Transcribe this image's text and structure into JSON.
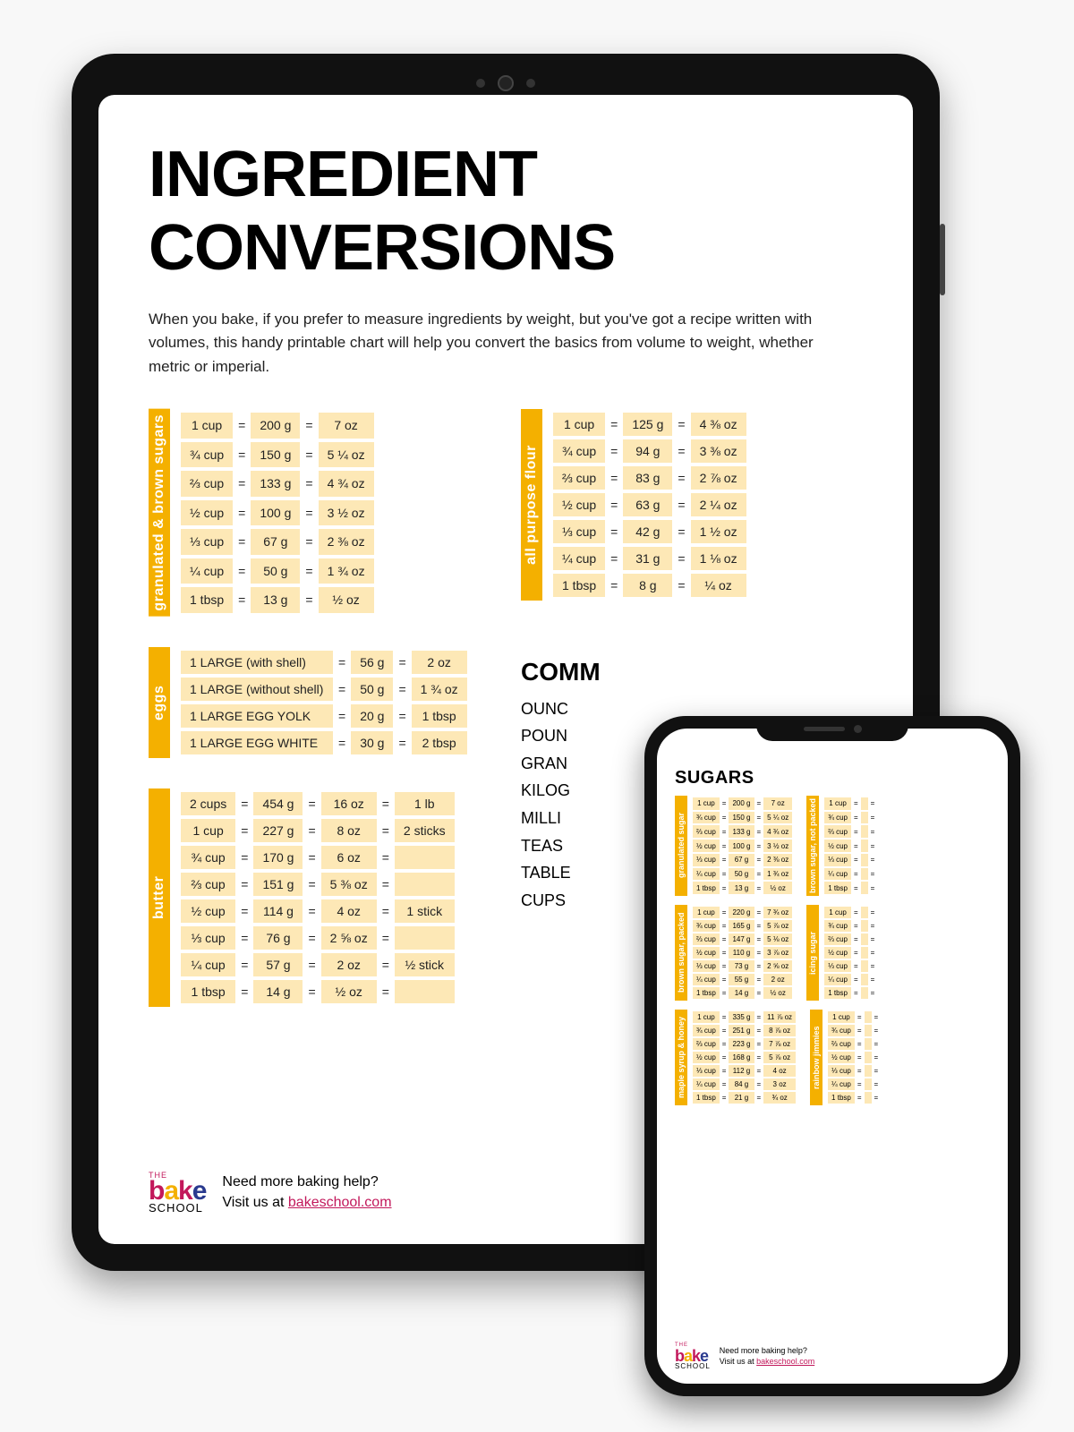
{
  "tablet": {
    "title": "INGREDIENT CONVERSIONS",
    "intro": "When you bake, if you prefer to measure ingredients by weight, but you've got a recipe written with volumes, this handy printable chart will help you convert the basics from volume to weight, whether metric or imperial.",
    "charts": {
      "sugars": {
        "label": "granulated & brown sugars",
        "rows": [
          [
            "1 cup",
            "200 g",
            "7 oz"
          ],
          [
            "¾ cup",
            "150 g",
            "5 ¼ oz"
          ],
          [
            "⅔ cup",
            "133 g",
            "4 ¾ oz"
          ],
          [
            "½ cup",
            "100 g",
            "3 ½ oz"
          ],
          [
            "⅓ cup",
            "67 g",
            "2 ⅜ oz"
          ],
          [
            "¼ cup",
            "50 g",
            "1 ¾ oz"
          ],
          [
            "1 tbsp",
            "13 g",
            "½ oz"
          ]
        ]
      },
      "flour": {
        "label": "all purpose flour",
        "rows": [
          [
            "1 cup",
            "125 g",
            "4 ⅜ oz"
          ],
          [
            "¾ cup",
            "94 g",
            "3 ⅜ oz"
          ],
          [
            "⅔ cup",
            "83 g",
            "2 ⅞ oz"
          ],
          [
            "½ cup",
            "63 g",
            "2 ¼ oz"
          ],
          [
            "⅓ cup",
            "42 g",
            "1 ½ oz"
          ],
          [
            "¼ cup",
            "31 g",
            "1 ⅛ oz"
          ],
          [
            "1 tbsp",
            "8 g",
            "¼ oz"
          ]
        ]
      },
      "eggs": {
        "label": "eggs",
        "rows": [
          [
            "1 LARGE (with shell)",
            "56 g",
            "2 oz"
          ],
          [
            "1 LARGE (without shell)",
            "50 g",
            "1 ¾ oz"
          ],
          [
            "1 LARGE EGG YOLK",
            "20 g",
            "1 tbsp"
          ],
          [
            "1 LARGE EGG WHITE",
            "30 g",
            "2 tbsp"
          ]
        ]
      },
      "butter": {
        "label": "butter",
        "rows": [
          [
            "2 cups",
            "454 g",
            "16 oz",
            "1 lb"
          ],
          [
            "1 cup",
            "227 g",
            "8 oz",
            "2 sticks"
          ],
          [
            "¾ cup",
            "170 g",
            "6 oz",
            ""
          ],
          [
            "⅔ cup",
            "151 g",
            "5 ⅜ oz",
            ""
          ],
          [
            "½ cup",
            "114 g",
            "4 oz",
            "1 stick"
          ],
          [
            "⅓ cup",
            "76 g",
            "2 ⅝ oz",
            ""
          ],
          [
            "¼ cup",
            "57 g",
            "2 oz",
            "½ stick"
          ],
          [
            "1 tbsp",
            "14 g",
            "½ oz",
            ""
          ]
        ]
      }
    },
    "abbrev": {
      "heading": "COMM",
      "lines": [
        "OUNC",
        "POUN",
        "GRAN",
        "KILOG",
        "MILLI",
        "TEAS",
        "TABLE",
        "CUPS"
      ]
    },
    "footer": {
      "help": "Need more baking help?",
      "visit": "Visit us at ",
      "link": "bakeschool.com"
    },
    "logo": {
      "the": "THE",
      "b": "b",
      "a": "a",
      "k": "k",
      "e": "e",
      "school": "SCHOOL"
    }
  },
  "phone": {
    "heading": "SUGARS",
    "charts": [
      {
        "label": "granulated sugar",
        "rows": [
          [
            "1 cup",
            "200 g",
            "7 oz"
          ],
          [
            "¾ cup",
            "150 g",
            "5 ¼ oz"
          ],
          [
            "⅔ cup",
            "133 g",
            "4 ¾ oz"
          ],
          [
            "½ cup",
            "100 g",
            "3 ½ oz"
          ],
          [
            "⅓ cup",
            "67 g",
            "2 ⅜ oz"
          ],
          [
            "¼ cup",
            "50 g",
            "1 ¾ oz"
          ],
          [
            "1 tbsp",
            "13 g",
            "½ oz"
          ]
        ]
      },
      {
        "label": "brown sugar, not packed",
        "rows": [
          [
            "1 cup",
            ""
          ],
          [
            "¾ cup",
            ""
          ],
          [
            "⅔ cup",
            ""
          ],
          [
            "½ cup",
            ""
          ],
          [
            "⅓ cup",
            ""
          ],
          [
            "¼ cup",
            ""
          ],
          [
            "1 tbsp",
            ""
          ]
        ]
      },
      {
        "label": "brown sugar, packed",
        "rows": [
          [
            "1 cup",
            "220 g",
            "7 ¾ oz"
          ],
          [
            "¾ cup",
            "165 g",
            "5 ⅞ oz"
          ],
          [
            "⅔ cup",
            "147 g",
            "5 ⅛ oz"
          ],
          [
            "½ cup",
            "110 g",
            "3 ⅞ oz"
          ],
          [
            "⅓ cup",
            "73 g",
            "2 ⅝ oz"
          ],
          [
            "¼ cup",
            "55 g",
            "2 oz"
          ],
          [
            "1 tbsp",
            "14 g",
            "½ oz"
          ]
        ]
      },
      {
        "label": "icing sugar",
        "rows": [
          [
            "1 cup",
            ""
          ],
          [
            "¾ cup",
            ""
          ],
          [
            "⅔ cup",
            ""
          ],
          [
            "½ cup",
            ""
          ],
          [
            "⅓ cup",
            ""
          ],
          [
            "¼ cup",
            ""
          ],
          [
            "1 tbsp",
            ""
          ]
        ]
      },
      {
        "label": "maple syrup & honey",
        "rows": [
          [
            "1 cup",
            "335 g",
            "11 ⅞ oz"
          ],
          [
            "¾ cup",
            "251 g",
            "8 ⅞ oz"
          ],
          [
            "⅔ cup",
            "223 g",
            "7 ⅞ oz"
          ],
          [
            "½ cup",
            "168 g",
            "5 ⅞ oz"
          ],
          [
            "⅓ cup",
            "112 g",
            "4 oz"
          ],
          [
            "¼ cup",
            "84 g",
            "3 oz"
          ],
          [
            "1 tbsp",
            "21 g",
            "¾ oz"
          ]
        ]
      },
      {
        "label": "rainbow jimmies",
        "rows": [
          [
            "1 cup",
            ""
          ],
          [
            "¾ cup",
            ""
          ],
          [
            "⅔ cup",
            ""
          ],
          [
            "½ cup",
            ""
          ],
          [
            "⅓ cup",
            ""
          ],
          [
            "¼ cup",
            ""
          ],
          [
            "1 tbsp",
            ""
          ]
        ]
      }
    ],
    "footer": {
      "help": "Need more baking help?",
      "visit": "Visit us at ",
      "link": "bakeschool.com"
    }
  }
}
